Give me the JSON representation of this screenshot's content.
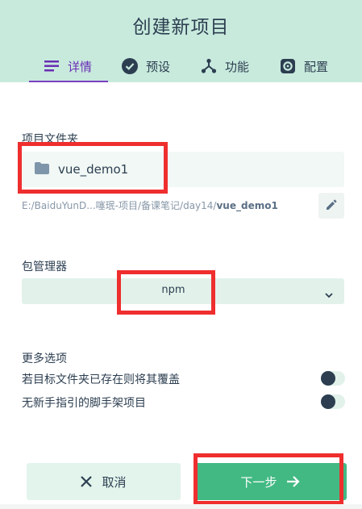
{
  "header": {
    "title": "创建新项目",
    "tabs": [
      {
        "label": "详情",
        "icon": "details-list-icon",
        "active": true
      },
      {
        "label": "预设",
        "icon": "check-circle-icon",
        "active": false
      },
      {
        "label": "功能",
        "icon": "features-tree-icon",
        "active": false
      },
      {
        "label": "配置",
        "icon": "gear-icon",
        "active": false
      }
    ]
  },
  "form": {
    "folder_label": "项目文件夹",
    "folder_value": "vue_demo1",
    "path_prefix": "E:/BaiduYunD...噻珉-项目/备课笔记/day14/",
    "path_current": "vue_demo1",
    "package_manager_label": "包管理器",
    "package_manager_value": "npm",
    "more_options_label": "更多选项",
    "options": [
      {
        "label": "若目标文件夹已存在则将其覆盖",
        "enabled": false
      },
      {
        "label": "无新手指引的脚手架项目",
        "enabled": false
      }
    ]
  },
  "actions": {
    "cancel_label": "取消",
    "next_label": "下一步"
  },
  "colors": {
    "header_bg": "#c8eadd",
    "accent": "#42b983",
    "tab_active": "#6a2eb5",
    "annotation_red": "#ef2e2e"
  }
}
